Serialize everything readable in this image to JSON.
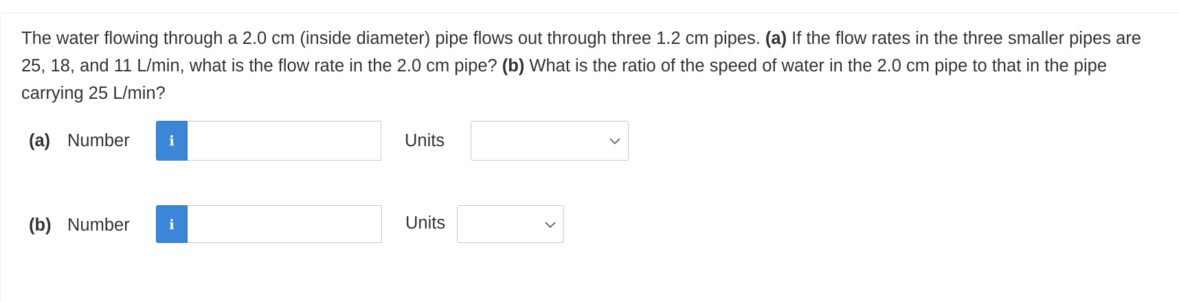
{
  "question": {
    "text_1": "The water flowing through a 2.0 cm (inside diameter) pipe flows out through three 1.2 cm pipes. ",
    "part_a_marker": "(a)",
    "text_2": " If the flow rates in the three smaller pipes are 25, 18, and 11 L/min, what is the flow rate in the 2.0 cm pipe? ",
    "part_b_marker": "(b)",
    "text_3": " What is the ratio of the speed of water in the 2.0 cm pipe to that in the pipe carrying 25 L/min?"
  },
  "parts": [
    {
      "label": "(a)",
      "number_label": "Number",
      "info_icon": "i",
      "number_value": "",
      "units_label": "Units",
      "units_selected": ""
    },
    {
      "label": "(b)",
      "number_label": "Number",
      "info_icon": "i",
      "number_value": "",
      "units_label": "Units",
      "units_selected": ""
    }
  ],
  "icons": {
    "info": "info-icon",
    "dropdown": "chevron-down-icon"
  },
  "colors": {
    "info_button": "#3b86d6",
    "text": "#333333",
    "border": "#c8c8c8"
  }
}
